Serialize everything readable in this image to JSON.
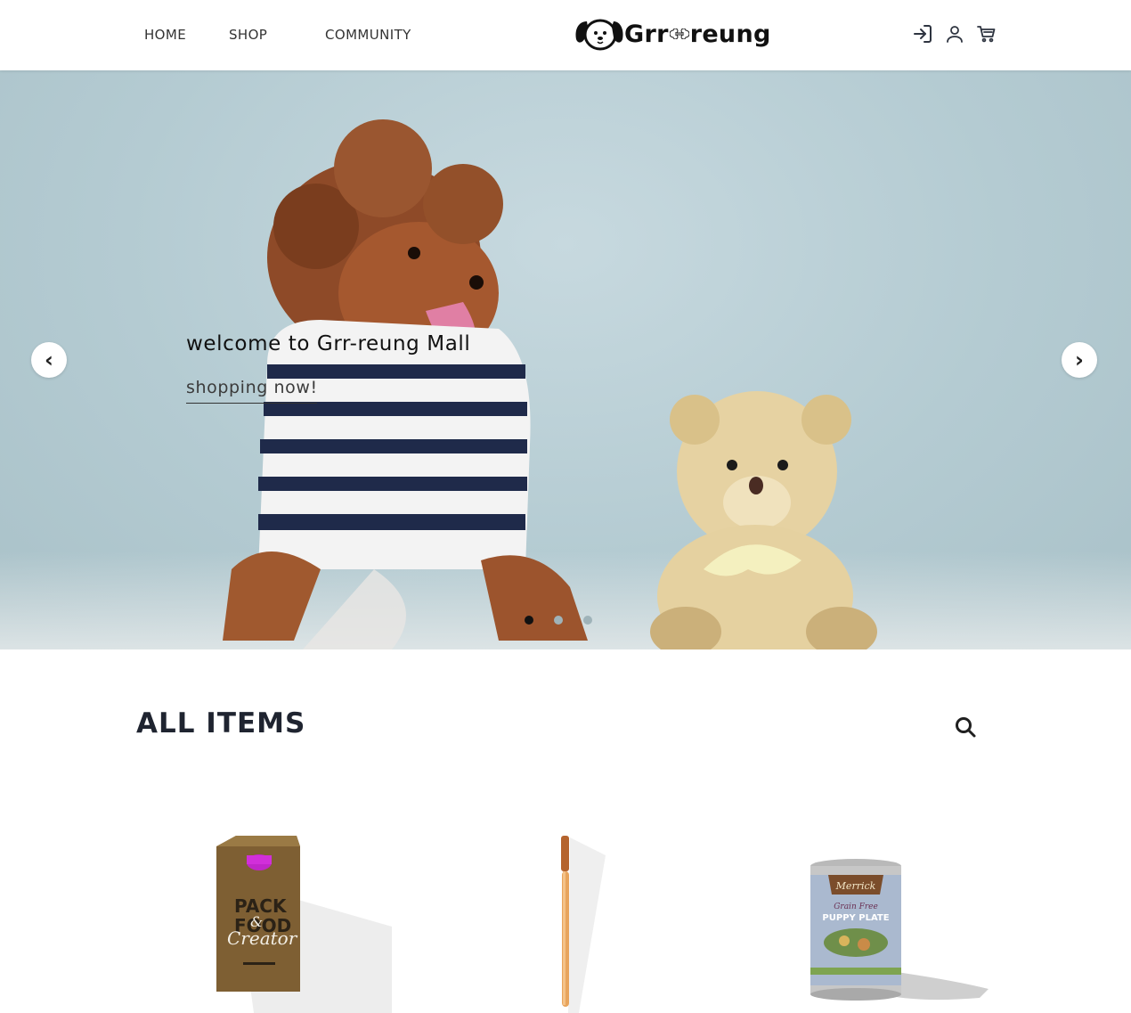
{
  "header": {
    "nav": [
      {
        "label": "HOME"
      },
      {
        "label": "SHOP"
      },
      {
        "label": "COMMUNITY"
      }
    ],
    "logo_text_left": "Grr",
    "logo_text_right": "reung",
    "icons": [
      "login-icon",
      "user-icon",
      "cart-icon"
    ]
  },
  "hero": {
    "title": "welcome to Grr-reung Mall",
    "cta": "shopping now!",
    "prev_arrow": "‹",
    "next_arrow": "›",
    "slides_total": 3,
    "active_slide": 1
  },
  "items_section": {
    "title": "ALL ITEMS",
    "search_icon": "search-icon"
  },
  "products": [
    {
      "image": "pack-food-carton",
      "text": [
        "PACK",
        "FOOD",
        "&",
        "Creator"
      ]
    },
    {
      "image": "toothbrush"
    },
    {
      "image": "dog-food-can",
      "text": [
        "Merrick",
        "Grain Free",
        "PUPPY PLATE"
      ]
    }
  ],
  "colors": {
    "hero_bg": "#b7cdd4",
    "text_dark": "#1f2430",
    "dot_active": "#111111",
    "dot_inactive": "#9fb3b9"
  }
}
